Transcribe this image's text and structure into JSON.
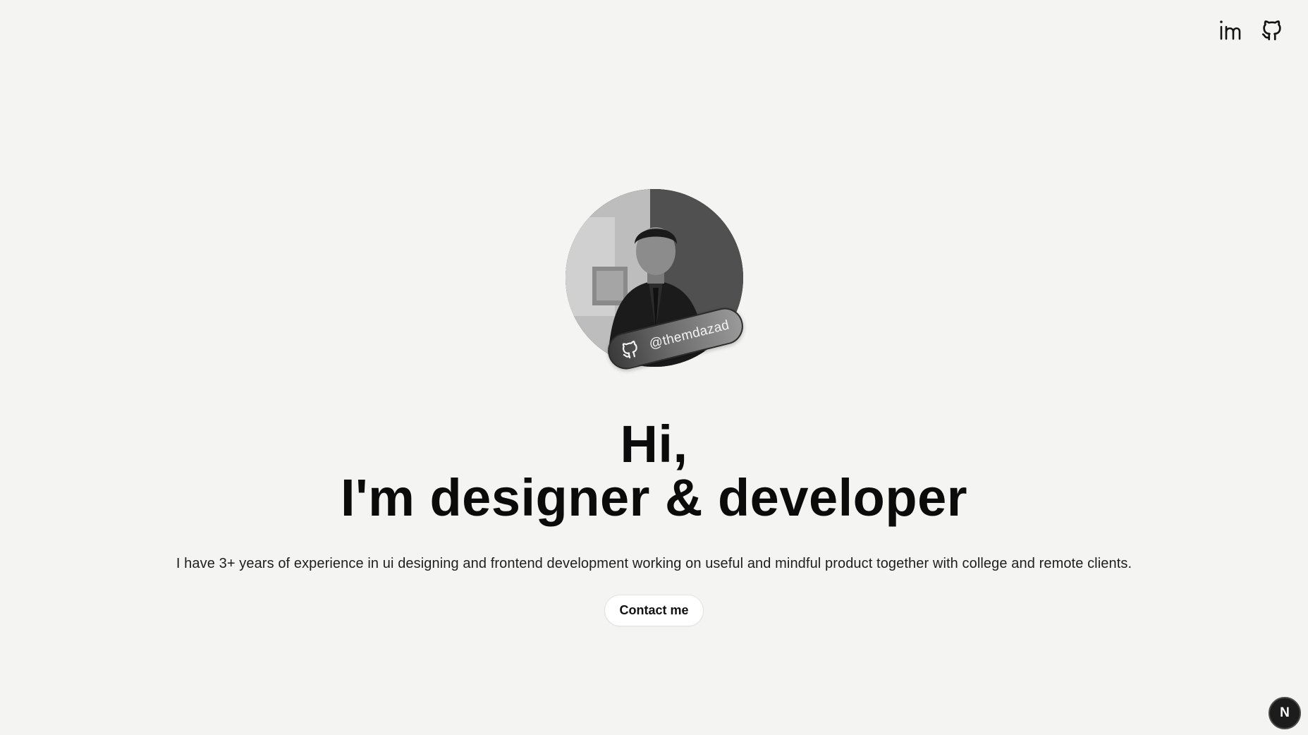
{
  "header": {
    "social_links": [
      {
        "icon": "linkedin-icon",
        "label": "LinkedIn"
      },
      {
        "icon": "github-icon",
        "label": "GitHub"
      }
    ]
  },
  "profile": {
    "github_handle": "@themdazad",
    "avatar_tone": "grayscale"
  },
  "hero": {
    "greeting": "Hi,",
    "title": "I'm designer & developer",
    "description": "I have 3+ years of experience in ui designing and frontend development working on useful and mindful product together with college and remote clients.",
    "cta_label": "Contact me"
  },
  "dev_badge": {
    "letter": "N"
  },
  "colors": {
    "background": "#f4f4f3",
    "text": "#0b0b0b",
    "button_bg": "#ffffff",
    "badge_bg": "#1c1c1c"
  }
}
